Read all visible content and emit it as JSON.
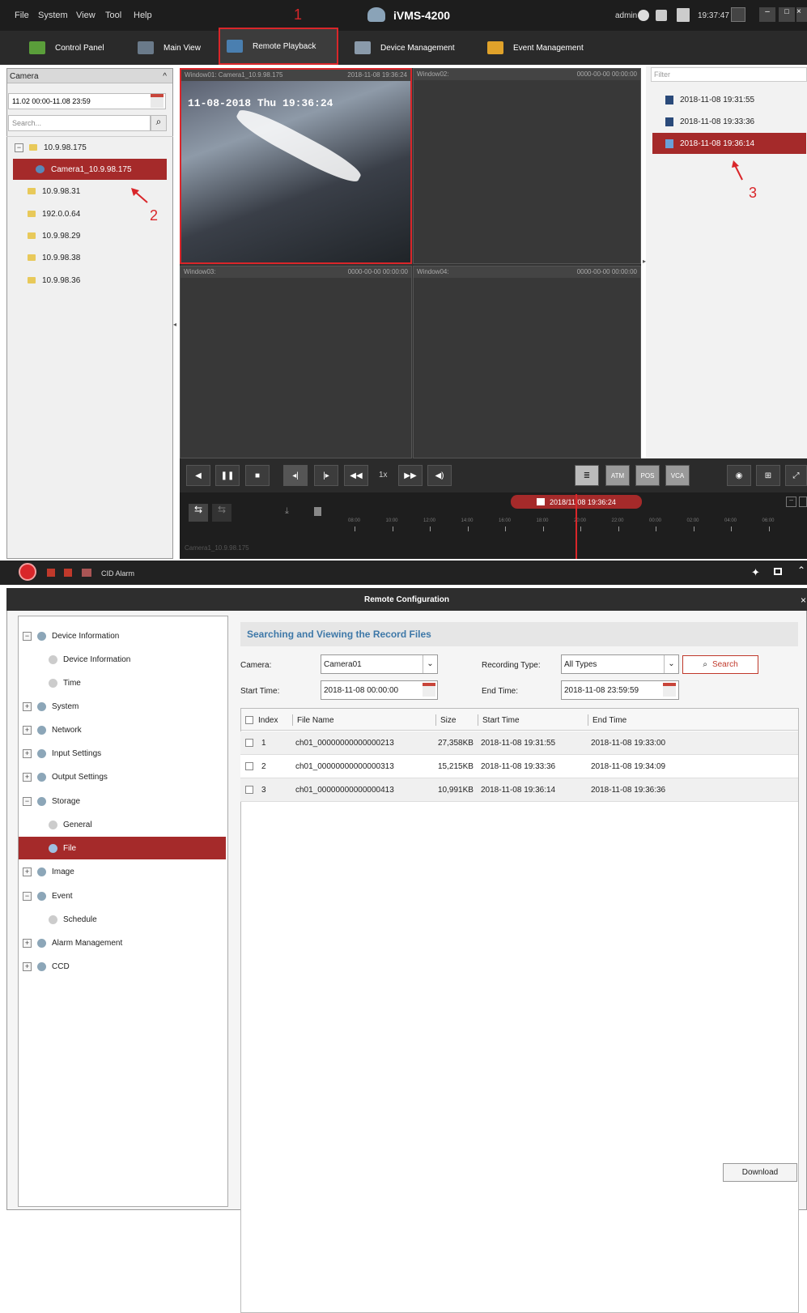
{
  "menu": [
    "File",
    "System",
    "View",
    "Tool",
    "Help"
  ],
  "app_title": "iVMS-4200",
  "status": {
    "user": "admin",
    "time": "19:37:47"
  },
  "tabs": [
    "Control Panel",
    "Main View",
    "Remote Playback",
    "Device Management",
    "Event Management"
  ],
  "annotations": [
    "1",
    "2",
    "3"
  ],
  "left": {
    "header": "Camera",
    "date_range": "11.02 00:00-11.08 23:59",
    "search_placeholder": "Search...",
    "tree": [
      "10.9.98.175",
      "Camera1_10.9.98.175",
      "10.9.98.31",
      "192.0.0.64",
      "10.9.98.29",
      "10.9.98.38",
      "10.9.98.36"
    ]
  },
  "windows": [
    {
      "label": "Window01: Camera1_10.9.98.175",
      "time": "2018-11-08 19:36:24"
    },
    {
      "label": "Window02:",
      "time": "0000-00-00 00:00:00"
    },
    {
      "label": "Window03:",
      "time": "0000-00-00 00:00:00"
    },
    {
      "label": "Window04:",
      "time": "0000-00-00 00:00:00"
    }
  ],
  "overlay": "11-08-2018 Thu 19:36:24",
  "right": {
    "filter_placeholder": "Filter",
    "records": [
      "2018-11-08 19:31:55",
      "2018-11-08 19:33:36",
      "2018-11-08 19:36:14"
    ]
  },
  "controls": {
    "speed": "1x"
  },
  "timeline": {
    "current": "2018/11/08 19:36:24",
    "ticks": [
      "08:00",
      "10:00",
      "12:00",
      "14:00",
      "16:00",
      "18:00",
      "20:00",
      "22:00",
      "00:00",
      "02:00",
      "04:00",
      "06:00"
    ],
    "track_label": "Camera1_10.9.98.175"
  },
  "alarm": {
    "label": "CID Alarm"
  },
  "rc": {
    "title": "Remote Configuration",
    "nav": [
      "Device Information",
      "Device Information",
      "Time",
      "System",
      "Network",
      "Input Settings",
      "Output Settings",
      "Storage",
      "General",
      "File",
      "Image",
      "Event",
      "Schedule",
      "Alarm Management",
      "CCD"
    ],
    "section": "Searching and Viewing the Record Files",
    "form": {
      "camera_label": "Camera:",
      "camera_value": "Camera01",
      "type_label": "Recording Type:",
      "type_value": "All Types",
      "search": "Search",
      "start_label": "Start Time:",
      "start_value": "2018-11-08 00:00:00",
      "end_label": "End Time:",
      "end_value": "2018-11-08 23:59:59"
    },
    "columns": [
      "Index",
      "File Name",
      "Size",
      "Start Time",
      "End Time"
    ],
    "rows": [
      [
        "1",
        "ch01_00000000000000213",
        "27,358KB",
        "2018-11-08 19:31:55",
        "2018-11-08 19:33:00"
      ],
      [
        "2",
        "ch01_00000000000000313",
        "15,215KB",
        "2018-11-08 19:33:36",
        "2018-11-08 19:34:09"
      ],
      [
        "3",
        "ch01_00000000000000413",
        "10,991KB",
        "2018-11-08 19:36:14",
        "2018-11-08 19:36:36"
      ]
    ],
    "download": "Download"
  }
}
